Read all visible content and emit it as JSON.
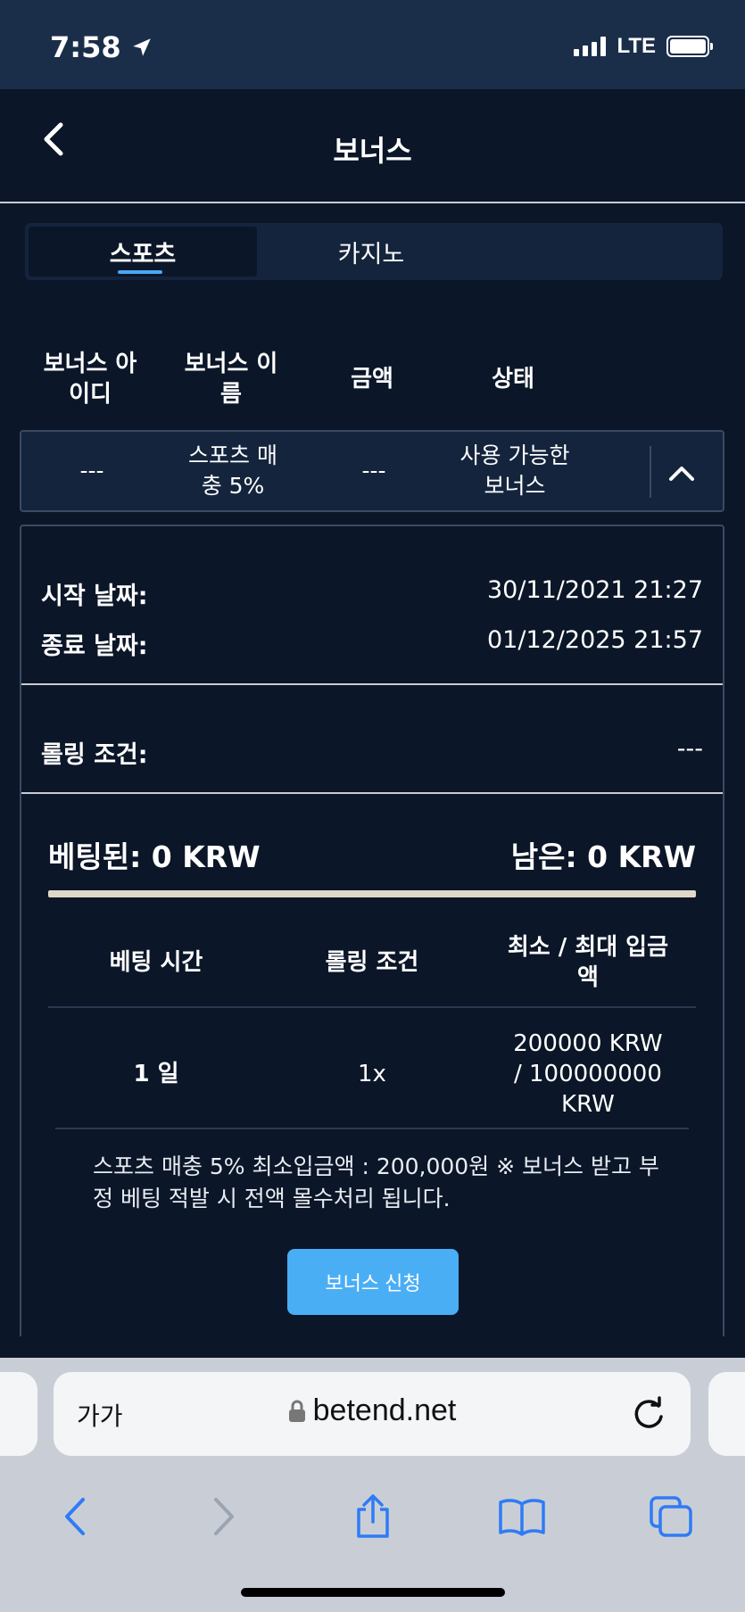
{
  "status_bar": {
    "time": "7:58",
    "network": "LTE"
  },
  "header": {
    "title": "보너스"
  },
  "tabs": [
    {
      "label": "스포츠",
      "active": true
    },
    {
      "label": "카지노",
      "active": false
    }
  ],
  "columns": [
    "보너스 아이디",
    "보너스 이름",
    "금액",
    "상태"
  ],
  "bonus_row": {
    "id": "---",
    "name": "스포츠 매충 5%",
    "amount": "---",
    "status": "사용 가능한 보너스"
  },
  "details": {
    "start_label": "시작 날짜:",
    "start_value": "30/11/2021 21:27",
    "end_label": "종료 날짜:",
    "end_value": "01/12/2025 21:57",
    "rolling_label": "롤링 조건:",
    "rolling_value": "---",
    "bet_label": "베팅된: 0 KRW",
    "remain_label": "남은: 0 KRW",
    "progress_fraction": 0
  },
  "rule_table": {
    "headers": [
      "베팅 시간",
      "롤링 조건",
      "최소 / 최대 입금액"
    ],
    "row": [
      "1 일",
      "1x",
      "200000 KRW / 100000000 KRW"
    ]
  },
  "note": "스포츠 매충 5% 최소입금액 : 200,000원 ※ 보너스 받고 부정 베팅 적발 시 전액 몰수처리 됩니다.",
  "apply_button": "보너스 신청",
  "browser": {
    "aa": "가가",
    "url": "betend.net"
  },
  "colors": {
    "background": "#0b1628",
    "accent": "#4aaef5",
    "panel": "#14243c"
  }
}
